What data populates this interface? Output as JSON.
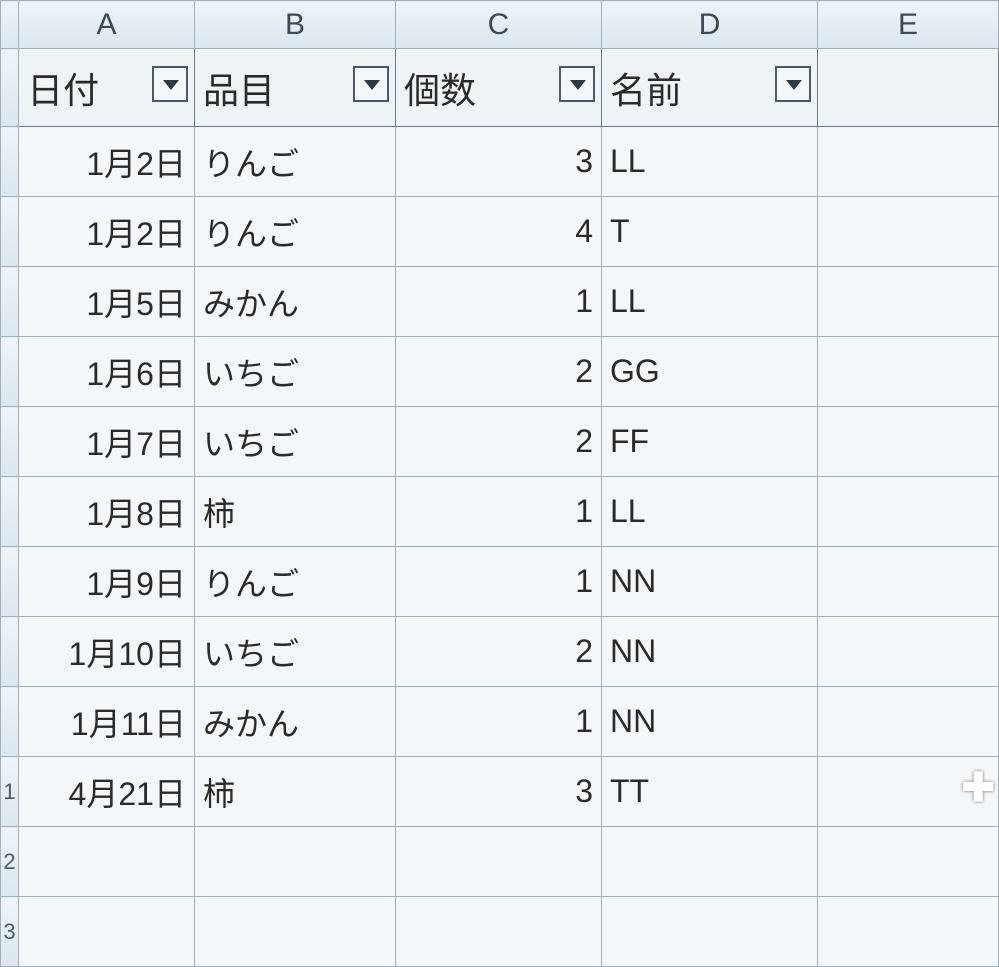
{
  "columns": {
    "A": "A",
    "B": "B",
    "C": "C",
    "D": "D",
    "E": "E"
  },
  "headers": {
    "date": "日付",
    "item": "品目",
    "qty": "個数",
    "name": "名前"
  },
  "rows": [
    {
      "date": "1月2日",
      "item": "りんご",
      "qty": "3",
      "name": "LL"
    },
    {
      "date": "1月2日",
      "item": "りんご",
      "qty": "4",
      "name": "T"
    },
    {
      "date": "1月5日",
      "item": "みかん",
      "qty": "1",
      "name": "LL"
    },
    {
      "date": "1月6日",
      "item": "いちご",
      "qty": "2",
      "name": "GG"
    },
    {
      "date": "1月7日",
      "item": "いちご",
      "qty": "2",
      "name": "FF"
    },
    {
      "date": "1月8日",
      "item": "柿",
      "qty": "1",
      "name": "LL"
    },
    {
      "date": "1月9日",
      "item": "りんご",
      "qty": "1",
      "name": "NN"
    },
    {
      "date": "1月10日",
      "item": "いちご",
      "qty": "2",
      "name": "NN"
    },
    {
      "date": "1月11日",
      "item": "みかん",
      "qty": "1",
      "name": "NN"
    },
    {
      "date": "4月21日",
      "item": "柿",
      "qty": "3",
      "name": "TT"
    }
  ],
  "row_numbers": [
    "",
    "",
    "",
    "",
    "",
    "",
    "",
    "",
    "",
    "",
    "1",
    "2",
    "3"
  ]
}
